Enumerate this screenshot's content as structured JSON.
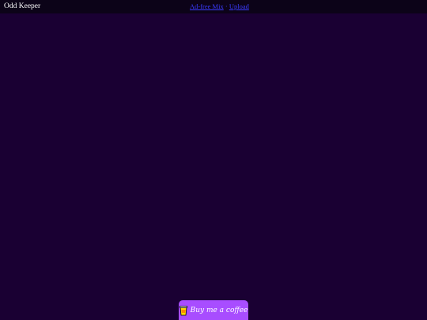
{
  "header": {
    "app_title": "Odd Keeper",
    "nav": {
      "links": [
        {
          "label": "Ad-free Mix"
        },
        {
          "label": "Upload"
        }
      ],
      "separator": "·"
    }
  },
  "footer": {
    "coffee_button": {
      "label": "Buy me a coffee",
      "icon": "coffee-cup-icon"
    }
  },
  "colors": {
    "background": "#1a0033",
    "topbar": "#0c0318",
    "accent": "#a84dff",
    "link": "#3b3bff"
  }
}
